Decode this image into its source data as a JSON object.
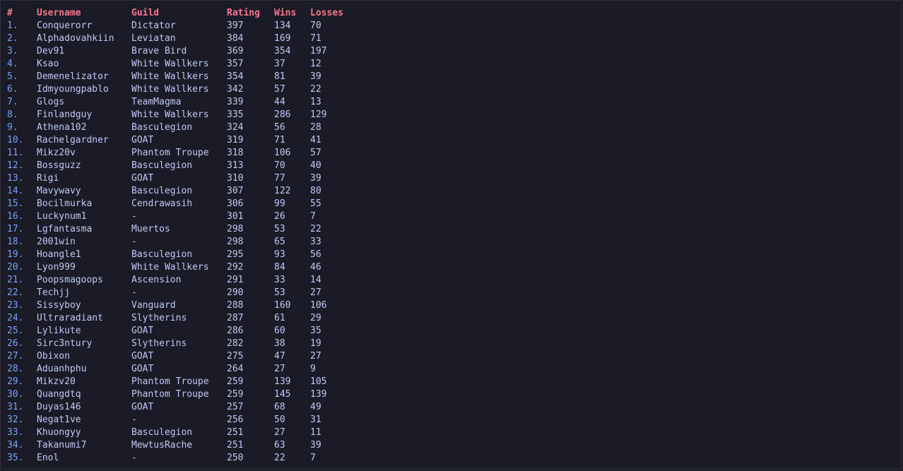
{
  "colors": {
    "background": "#1a1b26",
    "header": "#f7768e",
    "rank": "#7aa2f7",
    "text": "#c0caf5"
  },
  "leaderboard": {
    "headers": {
      "rank": "#",
      "username": "Username",
      "guild": "Guild",
      "rating": "Rating",
      "wins": "Wins",
      "losses": "Losses"
    },
    "rows": [
      {
        "rank": "1.",
        "username": "Conquerorr",
        "guild": "Dictator",
        "rating": "397",
        "wins": "134",
        "losses": "70"
      },
      {
        "rank": "2.",
        "username": "Alphadovahkiin",
        "guild": "Leviatan",
        "rating": "384",
        "wins": "169",
        "losses": "71"
      },
      {
        "rank": "3.",
        "username": "Dev91",
        "guild": "Brave Bird",
        "rating": "369",
        "wins": "354",
        "losses": "197"
      },
      {
        "rank": "4.",
        "username": "Ksao",
        "guild": "White Wallkers",
        "rating": "357",
        "wins": "37",
        "losses": "12"
      },
      {
        "rank": "5.",
        "username": "Demenelizator",
        "guild": "White Wallkers",
        "rating": "354",
        "wins": "81",
        "losses": "39"
      },
      {
        "rank": "6.",
        "username": "Idmyoungpablo",
        "guild": "White Wallkers",
        "rating": "342",
        "wins": "57",
        "losses": "22"
      },
      {
        "rank": "7.",
        "username": "Glogs",
        "guild": "TeamMagma",
        "rating": "339",
        "wins": "44",
        "losses": "13"
      },
      {
        "rank": "8.",
        "username": "Finlandguy",
        "guild": "White Wallkers",
        "rating": "335",
        "wins": "286",
        "losses": "129"
      },
      {
        "rank": "9.",
        "username": "Athena102",
        "guild": "Basculegion",
        "rating": "324",
        "wins": "56",
        "losses": "28"
      },
      {
        "rank": "10.",
        "username": "Rachelgardner",
        "guild": "GOAT",
        "rating": "319",
        "wins": "71",
        "losses": "41"
      },
      {
        "rank": "11.",
        "username": "Mikz20v",
        "guild": "Phantom Troupe",
        "rating": "318",
        "wins": "106",
        "losses": "57"
      },
      {
        "rank": "12.",
        "username": "Bossguzz",
        "guild": "Basculegion",
        "rating": "313",
        "wins": "70",
        "losses": "40"
      },
      {
        "rank": "13.",
        "username": "Rigi",
        "guild": "GOAT",
        "rating": "310",
        "wins": "77",
        "losses": "39"
      },
      {
        "rank": "14.",
        "username": "Mavywavy",
        "guild": "Basculegion",
        "rating": "307",
        "wins": "122",
        "losses": "80"
      },
      {
        "rank": "15.",
        "username": "Bocilmurka",
        "guild": "Cendrawasih",
        "rating": "306",
        "wins": "99",
        "losses": "55"
      },
      {
        "rank": "16.",
        "username": "Luckynum1",
        "guild": "-",
        "rating": "301",
        "wins": "26",
        "losses": "7"
      },
      {
        "rank": "17.",
        "username": "Lgfantasma",
        "guild": "Muertos",
        "rating": "298",
        "wins": "53",
        "losses": "22"
      },
      {
        "rank": "18.",
        "username": "2001win",
        "guild": "-",
        "rating": "298",
        "wins": "65",
        "losses": "33"
      },
      {
        "rank": "19.",
        "username": "Hoangle1",
        "guild": "Basculegion",
        "rating": "295",
        "wins": "93",
        "losses": "56"
      },
      {
        "rank": "20.",
        "username": "Lyon999",
        "guild": "White Wallkers",
        "rating": "292",
        "wins": "84",
        "losses": "46"
      },
      {
        "rank": "21.",
        "username": "Poopsmagoops",
        "guild": "Ascension",
        "rating": "291",
        "wins": "33",
        "losses": "14"
      },
      {
        "rank": "22.",
        "username": "Techjj",
        "guild": "-",
        "rating": "290",
        "wins": "53",
        "losses": "27"
      },
      {
        "rank": "23.",
        "username": "Sissyboy",
        "guild": "Vanguard",
        "rating": "288",
        "wins": "160",
        "losses": "106"
      },
      {
        "rank": "24.",
        "username": "Ultraradiant",
        "guild": "Slytherins",
        "rating": "287",
        "wins": "61",
        "losses": "29"
      },
      {
        "rank": "25.",
        "username": "Lylikute",
        "guild": "GOAT",
        "rating": "286",
        "wins": "60",
        "losses": "35"
      },
      {
        "rank": "26.",
        "username": "Sirc3ntury",
        "guild": "Slytherins",
        "rating": "282",
        "wins": "38",
        "losses": "19"
      },
      {
        "rank": "27.",
        "username": "Obixon",
        "guild": "GOAT",
        "rating": "275",
        "wins": "47",
        "losses": "27"
      },
      {
        "rank": "28.",
        "username": "Aduanhphu",
        "guild": "GOAT",
        "rating": "264",
        "wins": "27",
        "losses": "9"
      },
      {
        "rank": "29.",
        "username": "Mikzv20",
        "guild": "Phantom Troupe",
        "rating": "259",
        "wins": "139",
        "losses": "105"
      },
      {
        "rank": "30.",
        "username": "Quangdtq",
        "guild": "Phantom Troupe",
        "rating": "259",
        "wins": "145",
        "losses": "139"
      },
      {
        "rank": "31.",
        "username": "Duyas146",
        "guild": "GOAT",
        "rating": "257",
        "wins": "68",
        "losses": "49"
      },
      {
        "rank": "32.",
        "username": "Negat1ve",
        "guild": "-",
        "rating": "256",
        "wins": "50",
        "losses": "31"
      },
      {
        "rank": "33.",
        "username": "Khuongyy",
        "guild": "Basculegion",
        "rating": "251",
        "wins": "27",
        "losses": "11"
      },
      {
        "rank": "34.",
        "username": "Takanumi7",
        "guild": "MewtusRache",
        "rating": "251",
        "wins": "63",
        "losses": "39"
      },
      {
        "rank": "35.",
        "username": "Enol",
        "guild": "-",
        "rating": "250",
        "wins": "22",
        "losses": "7"
      }
    ]
  }
}
